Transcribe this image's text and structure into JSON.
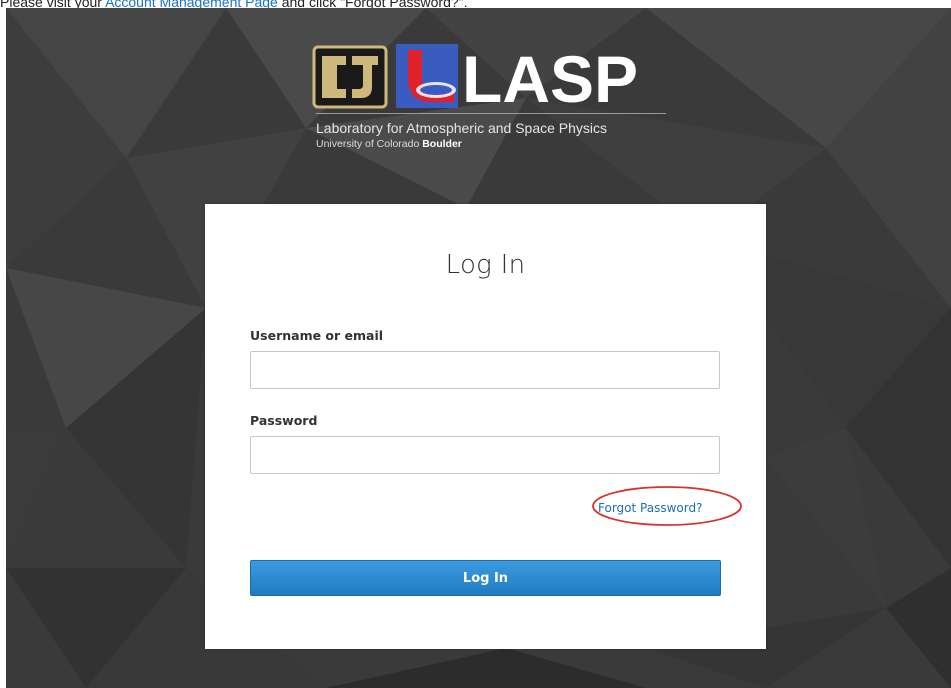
{
  "instruction": {
    "prefix": "Please visit your ",
    "link": "Account Management Page",
    "suffix": " and click \"Forgot Password?\"."
  },
  "brand": {
    "cu_logo_letters": "CU",
    "lasp_wordmark": "LASP",
    "subtitle": "Laboratory for Atmospheric and Space Physics",
    "university_prefix": "University of Colorado ",
    "university_bold": "Boulder"
  },
  "login": {
    "title": "Log In",
    "username_label": "Username or email",
    "username_value": "",
    "password_label": "Password",
    "password_value": "",
    "forgot_link": "Forgot Password?",
    "submit_label": "Log In"
  },
  "colors": {
    "link": "#1a73c9",
    "button": "#2a88cf",
    "highlight_circle": "#d9322b",
    "cu_gold": "#cfb87c",
    "lasp_blue": "#3a5bbf",
    "lasp_red": "#e0202b"
  }
}
